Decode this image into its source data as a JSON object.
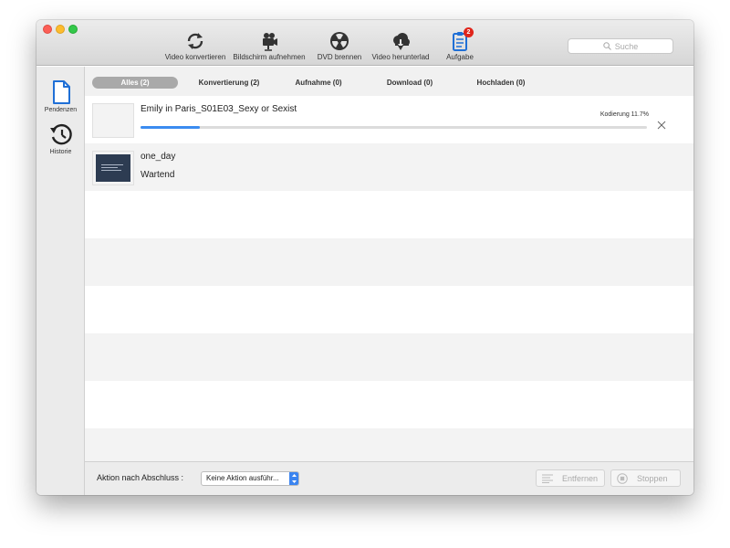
{
  "toolbar": {
    "tools": [
      {
        "label": "Video konvertieren",
        "icon": "refresh-icon"
      },
      {
        "label": "Bildschirm aufnehmen",
        "icon": "video-camera-icon"
      },
      {
        "label": "DVD brennen",
        "icon": "radiation-disc-icon"
      },
      {
        "label": "Video herunterlad",
        "icon": "cloud-download-icon"
      },
      {
        "label": "Aufgabe",
        "icon": "clipboard-icon",
        "badge": "2"
      }
    ],
    "search": {
      "placeholder": "Suche"
    }
  },
  "sidebar": {
    "items": [
      {
        "label": "Pendenzen",
        "icon": "document-icon"
      },
      {
        "label": "Historie",
        "icon": "history-icon"
      }
    ]
  },
  "tabs": [
    {
      "label": "Alles (2)",
      "active": true
    },
    {
      "label": "Konvertierung (2)",
      "active": false
    },
    {
      "label": "Aufnahme (0)",
      "active": false
    },
    {
      "label": "Download (0)",
      "active": false
    },
    {
      "label": "Hochladen (0)",
      "active": false
    }
  ],
  "tasks": [
    {
      "name": "Emily in Paris_S01E03_Sexy or Sexist",
      "progress_label": "Kodierung 11.7%",
      "progress": 0.117
    },
    {
      "name": "one_day",
      "status": "Wartend"
    }
  ],
  "footer": {
    "action_label": "Aktion nach Abschluss :",
    "action_value": "Keine Aktion ausführ...",
    "remove_label": "Entfernen",
    "stop_label": "Stoppen"
  },
  "colors": {
    "accent": "#3b8cf0",
    "badge": "#e0251b",
    "icon_blue": "#1f6fd6",
    "active_tab": "#a9a9a9"
  }
}
